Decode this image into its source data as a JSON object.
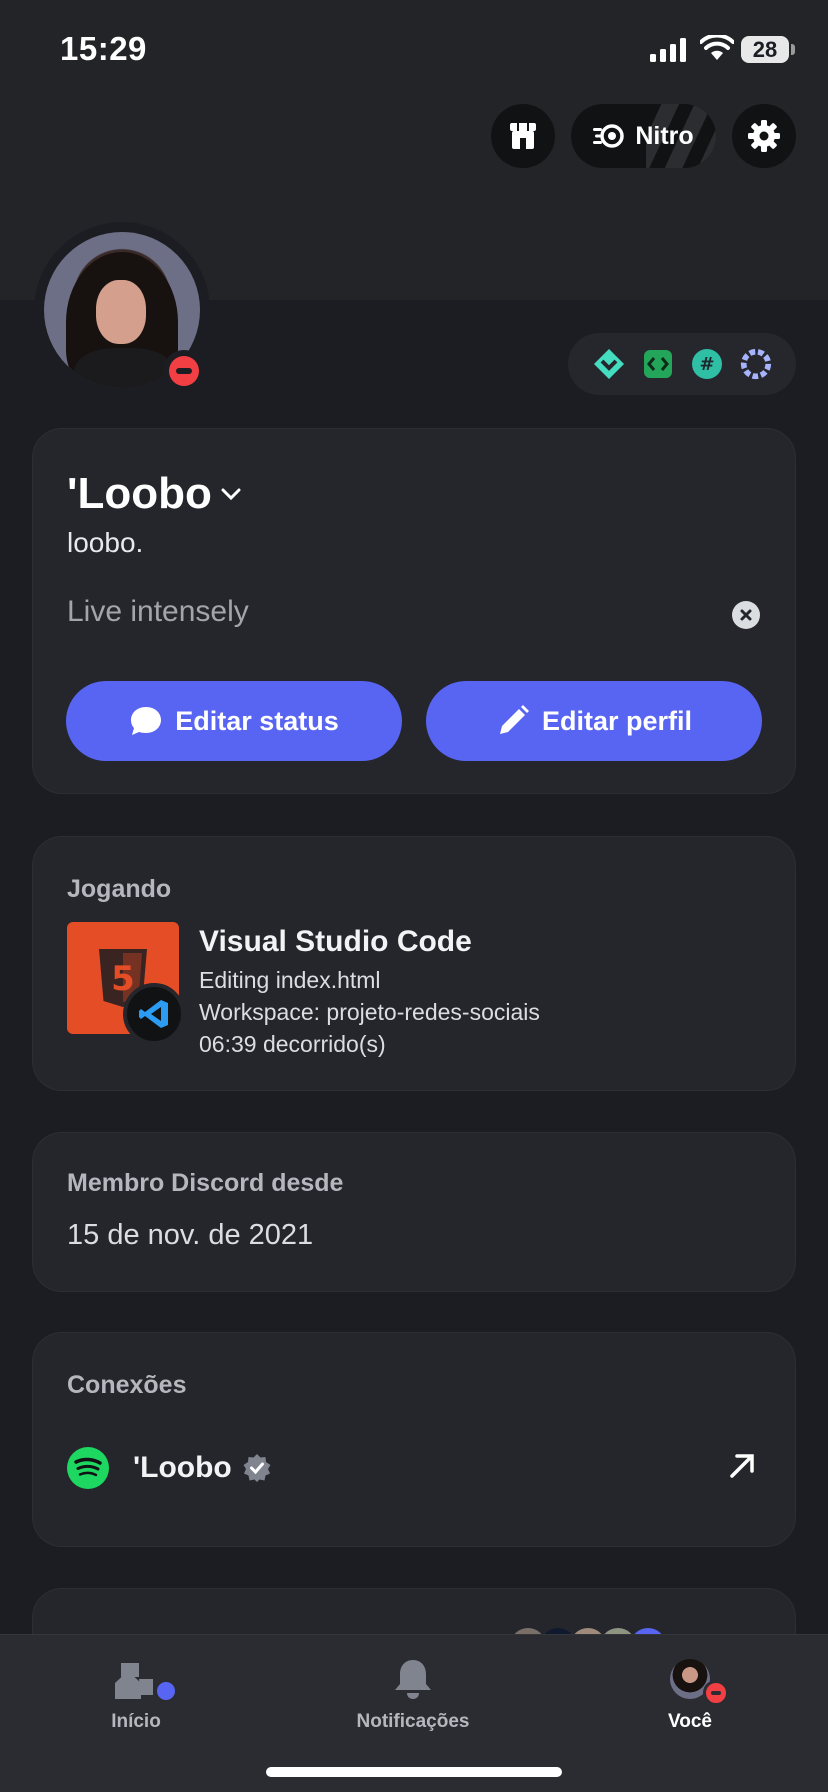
{
  "status_bar": {
    "time": "15:29",
    "battery": "28"
  },
  "header": {
    "nitro_label": "Nitro"
  },
  "profile": {
    "display_name": "'Loobo",
    "username": "loobo.",
    "custom_status": "Live intensely",
    "edit_status_label": "Editar status",
    "edit_profile_label": "Editar perfil"
  },
  "activity": {
    "heading": "Jogando",
    "app_name": "Visual Studio Code",
    "details": "Editing index.html",
    "workspace": "Workspace: projeto-redes-sociais",
    "elapsed": "06:39 decorrido(s)"
  },
  "member": {
    "heading": "Membro Discord desde",
    "date": "15 de nov. de 2021"
  },
  "connections": {
    "heading": "Conexões",
    "items": [
      {
        "service": "spotify-icon",
        "name": "'Loobo",
        "verified": true
      }
    ]
  },
  "tabs": [
    {
      "label": "Início",
      "icon": "home-icon"
    },
    {
      "label": "Notificações",
      "icon": "bell-icon"
    },
    {
      "label": "Você",
      "icon": "avatar"
    }
  ],
  "colors": {
    "blurple": "#5865f2",
    "dnd": "#f23f43",
    "spotify": "#1ed760",
    "html5": "#e44d26",
    "vscode": "#2b9cf2"
  }
}
